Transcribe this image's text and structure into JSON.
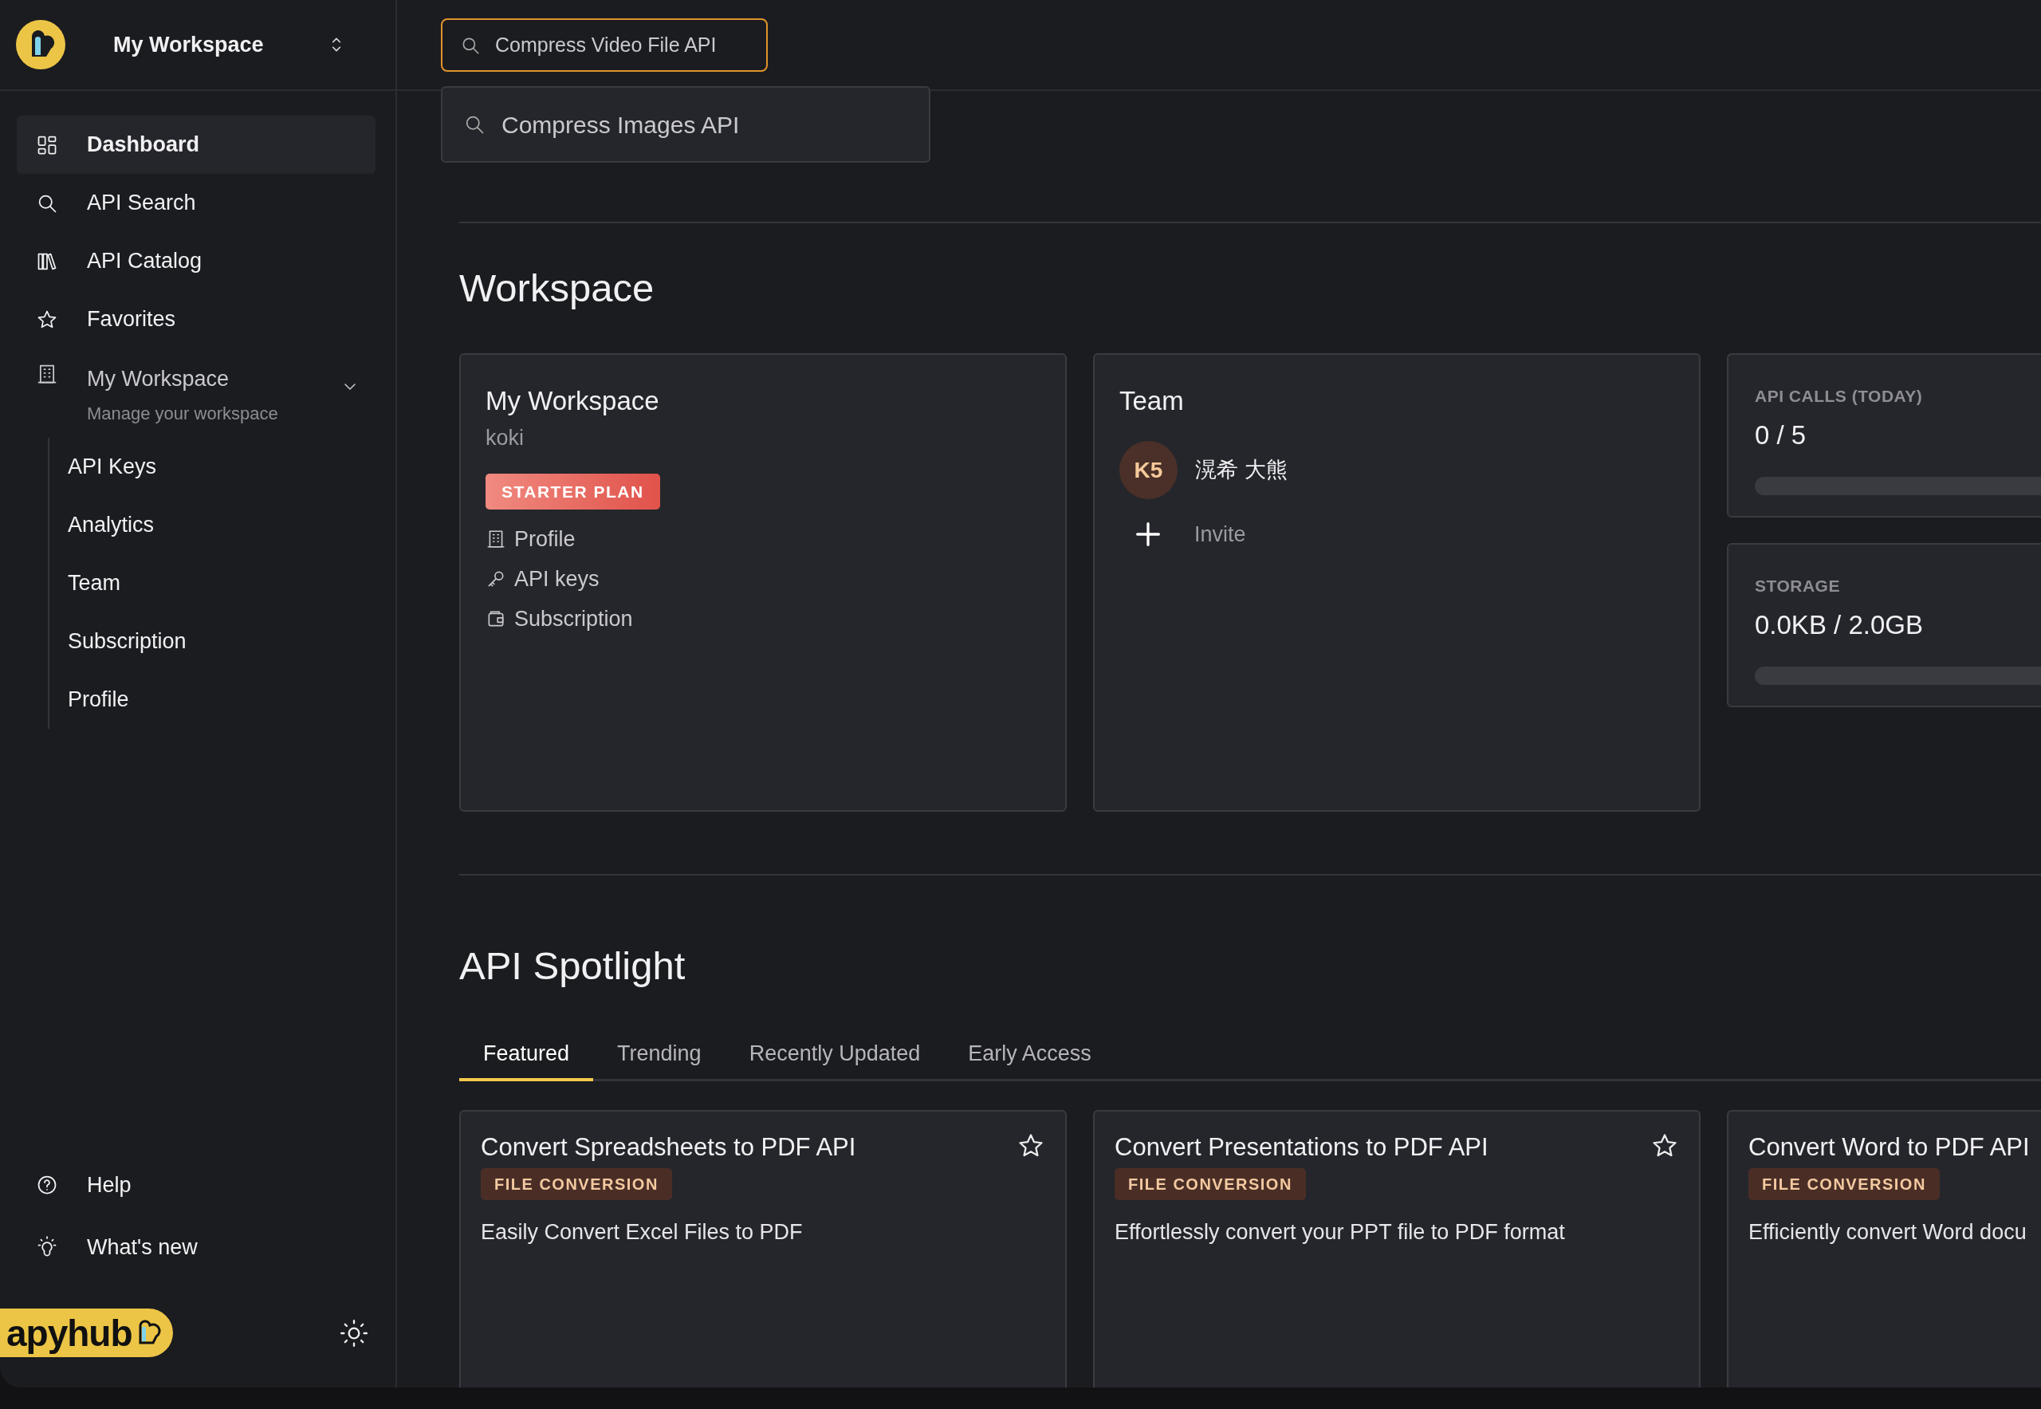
{
  "workspace_switcher": {
    "name": "My Workspace"
  },
  "search": {
    "value": "Compress Video File API",
    "suggestions": [
      {
        "label": "Compress Images API"
      }
    ]
  },
  "sidebar": {
    "items": [
      {
        "label": "Dashboard",
        "selected": true
      },
      {
        "label": "API Search",
        "selected": false
      },
      {
        "label": "API Catalog",
        "selected": false
      },
      {
        "label": "Favorites",
        "selected": false
      },
      {
        "label": "My Workspace",
        "subtitle": "Manage your workspace",
        "selected": false,
        "expanded": true,
        "children": [
          {
            "label": "API Keys",
            "selected": false
          },
          {
            "label": "Analytics",
            "selected": false
          },
          {
            "label": "Team",
            "selected": false
          },
          {
            "label": "Subscription",
            "selected": false
          },
          {
            "label": "Profile",
            "selected": false
          }
        ]
      }
    ],
    "footer_links": [
      {
        "label": "Help"
      },
      {
        "label": "What's new"
      }
    ],
    "brand": "apyhub"
  },
  "workspace": {
    "heading": "Workspace",
    "workspace_card": {
      "title": "My Workspace",
      "owner": "koki",
      "plan": "STARTER PLAN",
      "links": [
        {
          "label": "Profile"
        },
        {
          "label": "API keys"
        },
        {
          "label": "Subscription"
        }
      ]
    },
    "team_card": {
      "title": "Team",
      "members": [
        {
          "initials": "K5",
          "name": "滉希 大熊"
        }
      ],
      "invite": "Invite"
    },
    "stats": [
      {
        "label": "API CALLS (TODAY)",
        "value": "0 / 5",
        "level": 0
      },
      {
        "label": "STORAGE",
        "value": "0.0KB / 2.0GB",
        "level": 0
      }
    ]
  },
  "spotlight": {
    "heading": "API Spotlight",
    "tabs": [
      {
        "label": "Featured",
        "selected": true
      },
      {
        "label": "Trending",
        "selected": false
      },
      {
        "label": "Recently Updated",
        "selected": false
      },
      {
        "label": "Early Access",
        "selected": false
      }
    ],
    "cards": [
      {
        "title": "Convert Spreadsheets to PDF API",
        "category": "FILE CONVERSION",
        "description": "Easily Convert Excel Files to PDF",
        "favorite": false
      },
      {
        "title": "Convert Presentations to PDF API",
        "category": "FILE CONVERSION",
        "description": "Effortlessly convert your PPT file to PDF format",
        "favorite": false
      },
      {
        "title": "Convert Word to PDF API",
        "category": "FILE CONVERSION",
        "description": "Efficiently convert Word docu"
      }
    ]
  }
}
